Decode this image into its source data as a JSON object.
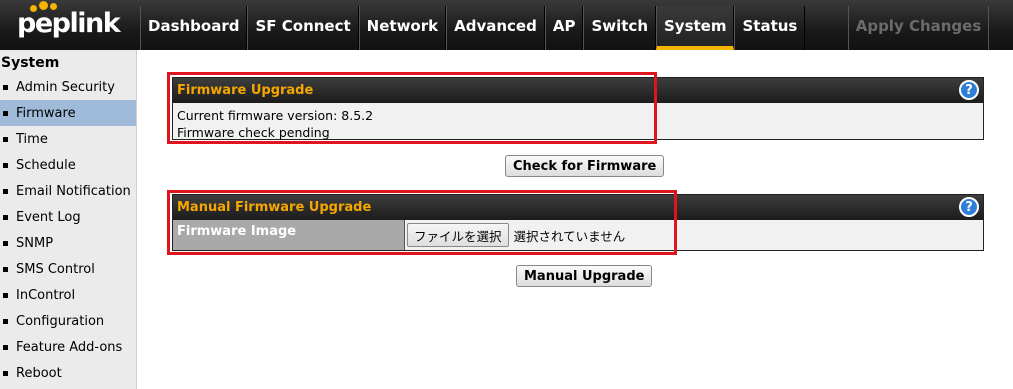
{
  "brand": {
    "logo_text": "peplink",
    "dot_color": "#f5b400"
  },
  "nav": {
    "tabs": [
      "Dashboard",
      "SF Connect",
      "Network",
      "Advanced",
      "AP",
      "Switch",
      "System",
      "Status"
    ],
    "active": "System",
    "apply_label": "Apply Changes"
  },
  "sidebar": {
    "heading": "System",
    "items": [
      "Admin Security",
      "Firmware",
      "Time",
      "Schedule",
      "Email Notification",
      "Event Log",
      "SNMP",
      "SMS Control",
      "InControl",
      "Configuration",
      "Feature Add-ons",
      "Reboot"
    ],
    "active": "Firmware"
  },
  "firmware_upgrade": {
    "title": "Firmware Upgrade",
    "current_version": "Current firmware version: 8.5.2",
    "check_status": "Firmware check pending",
    "help_icon": "question-icon",
    "check_button": "Check for Firmware"
  },
  "manual_upgrade": {
    "title": "Manual Firmware Upgrade",
    "image_label": "Firmware Image",
    "file_button": "ファイルを選択",
    "file_status": "選択されていません",
    "help_icon": "question-icon",
    "upgrade_button": "Manual Upgrade"
  },
  "colors": {
    "accent": "#f5a700",
    "highlight": "#e0141e",
    "active_sidebar": "#9fbbd9"
  }
}
